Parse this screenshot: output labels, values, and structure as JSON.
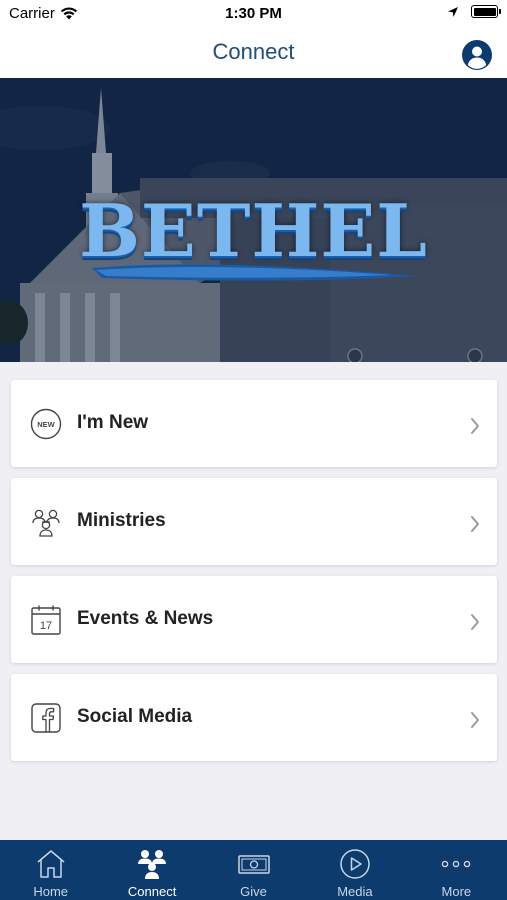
{
  "status_bar": {
    "carrier": "Carrier",
    "time": "1:30 PM"
  },
  "nav": {
    "title": "Connect"
  },
  "hero": {
    "logo_text": "BETHEL"
  },
  "menu": [
    {
      "label": "I'm New",
      "icon": "new-badge-icon",
      "icon_text": "NEW"
    },
    {
      "label": "Ministries",
      "icon": "people-group-icon"
    },
    {
      "label": "Events & News",
      "icon": "calendar-icon",
      "icon_text": "17"
    },
    {
      "label": "Social Media",
      "icon": "facebook-icon"
    }
  ],
  "tab_bar": {
    "active": "Connect",
    "tabs": [
      {
        "label": "Home",
        "icon": "home-icon"
      },
      {
        "label": "Connect",
        "icon": "people-group-icon"
      },
      {
        "label": "Give",
        "icon": "cash-icon"
      },
      {
        "label": "Media",
        "icon": "play-circle-icon"
      },
      {
        "label": "More",
        "icon": "more-dots-icon"
      }
    ]
  },
  "colors": {
    "nav_title": "#1f4e79",
    "tab_bar_bg": "#0d3b6e",
    "logo_blue": "#7ab8ef"
  }
}
